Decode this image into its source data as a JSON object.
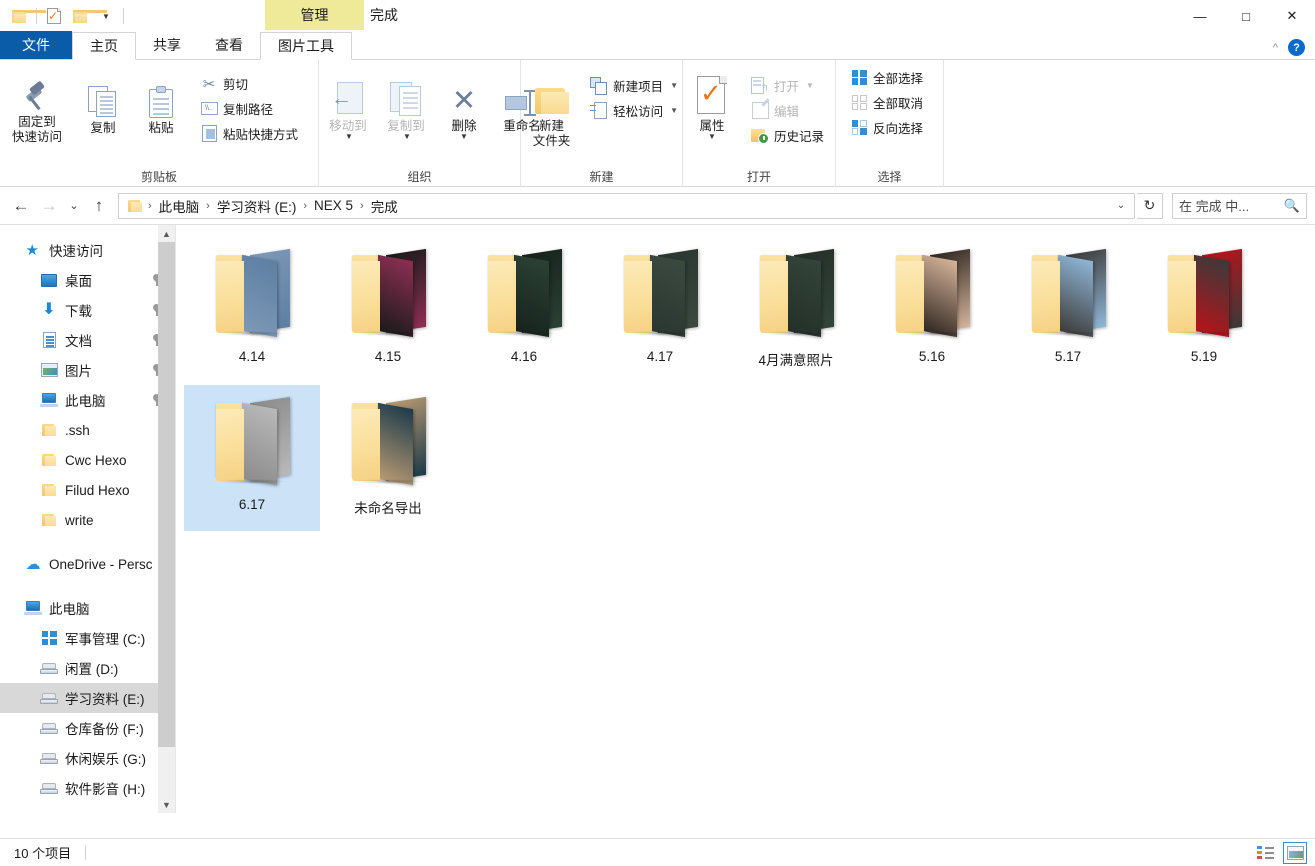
{
  "titlebar": {
    "quick_access": [
      {
        "name": "folder-icon",
        "label": "文件夹"
      },
      {
        "name": "properties-checkmark-icon",
        "label": "属性"
      },
      {
        "name": "new-folder-icon",
        "label": "新建文件夹"
      },
      {
        "name": "customize-dropdown-icon",
        "label": "自定义快速访问工具栏"
      }
    ],
    "context_tab": "管理",
    "window_title": "完成",
    "minimize": "—",
    "maximize": "□",
    "close": "✕"
  },
  "tabs": [
    {
      "label": "文件",
      "type": "file"
    },
    {
      "label": "主页",
      "type": "active"
    },
    {
      "label": "共享",
      "type": "normal"
    },
    {
      "label": "查看",
      "type": "normal"
    },
    {
      "label": "图片工具",
      "type": "context"
    }
  ],
  "ribbon": {
    "collapse_label": "^",
    "help_label": "?",
    "groups": [
      {
        "label": "剪贴板",
        "big": [
          {
            "label": "固定到\n快速访问",
            "line1": "固定到",
            "line2": "快速访问",
            "icon": "pin-icon"
          },
          {
            "label": "复制",
            "icon": "copy-icon"
          },
          {
            "label": "粘贴",
            "icon": "paste-icon"
          }
        ],
        "small": [
          {
            "label": "剪切",
            "icon": "scissors-icon"
          },
          {
            "label": "复制路径",
            "icon": "copy-path-icon"
          },
          {
            "label": "粘贴快捷方式",
            "icon": "paste-shortcut-icon"
          }
        ]
      },
      {
        "label": "组织",
        "big": [
          {
            "label": "移动到",
            "icon": "move-to-icon",
            "disabled": true,
            "caret": true
          },
          {
            "label": "复制到",
            "icon": "copy-to-icon",
            "disabled": true,
            "caret": true
          },
          {
            "label": "删除",
            "icon": "delete-icon",
            "caret": true
          },
          {
            "label": "重命名",
            "icon": "rename-icon"
          }
        ]
      },
      {
        "label": "新建",
        "big": [
          {
            "line1": "新建",
            "line2": "文件夹",
            "icon": "new-folder-icon"
          }
        ],
        "small": [
          {
            "label": "新建项目",
            "icon": "new-item-icon",
            "caret": true
          },
          {
            "label": "轻松访问",
            "icon": "easy-access-icon",
            "caret": true
          }
        ]
      },
      {
        "label": "打开",
        "big": [
          {
            "label": "属性",
            "icon": "properties-icon",
            "caret": true
          }
        ],
        "small": [
          {
            "label": "打开",
            "icon": "open-icon",
            "disabled": true,
            "caret": true
          },
          {
            "label": "编辑",
            "icon": "edit-icon",
            "disabled": true
          },
          {
            "label": "历史记录",
            "icon": "history-icon"
          }
        ]
      },
      {
        "label": "选择",
        "small": [
          {
            "label": "全部选择",
            "icon": "select-all-icon"
          },
          {
            "label": "全部取消",
            "icon": "select-none-icon"
          },
          {
            "label": "反向选择",
            "icon": "invert-selection-icon"
          }
        ]
      }
    ]
  },
  "addressbar": {
    "back": "←",
    "forward": "→",
    "recent": "⌄",
    "up": "↑",
    "breadcrumbs": [
      "此电脑",
      "学习资料 (E:)",
      "NEX 5",
      "完成"
    ],
    "dropdown": "⌄",
    "refresh": "↻",
    "search_placeholder": "在 完成 中...",
    "search_value": ""
  },
  "navpane": {
    "items": [
      {
        "label": "快速访问",
        "icon": "quick-access-star-icon",
        "level": 0,
        "pinned": false,
        "selected": false
      },
      {
        "label": "桌面",
        "icon": "desktop-icon",
        "level": 1,
        "pinned": true,
        "selected": false
      },
      {
        "label": "下载",
        "icon": "downloads-icon",
        "level": 1,
        "pinned": true,
        "selected": false
      },
      {
        "label": "文档",
        "icon": "documents-icon",
        "level": 1,
        "pinned": true,
        "selected": false
      },
      {
        "label": "图片",
        "icon": "pictures-icon",
        "level": 1,
        "pinned": true,
        "selected": false
      },
      {
        "label": "此电脑",
        "icon": "this-pc-icon",
        "level": 1,
        "pinned": true,
        "selected": false
      },
      {
        "label": ".ssh",
        "icon": "folder-icon",
        "level": 1,
        "pinned": false,
        "selected": false
      },
      {
        "label": "Cwc Hexo",
        "icon": "folder-icon",
        "level": 1,
        "pinned": false,
        "selected": false
      },
      {
        "label": "Filud Hexo",
        "icon": "folder-icon",
        "level": 1,
        "pinned": false,
        "selected": false
      },
      {
        "label": "write",
        "icon": "folder-icon",
        "level": 1,
        "pinned": false,
        "selected": false
      },
      {
        "label": "",
        "icon": "spacer",
        "level": 0,
        "spacer": true
      },
      {
        "label": "OneDrive - Persc",
        "icon": "onedrive-icon",
        "level": 0,
        "pinned": false,
        "selected": false
      },
      {
        "label": "",
        "icon": "spacer",
        "level": 0,
        "spacer": true
      },
      {
        "label": "此电脑",
        "icon": "this-pc-icon",
        "level": 0,
        "pinned": false,
        "selected": false
      },
      {
        "label": "军事管理 (C:)",
        "icon": "windows-drive-icon",
        "level": 1,
        "pinned": false,
        "selected": false
      },
      {
        "label": "闲置 (D:)",
        "icon": "drive-icon",
        "level": 1,
        "pinned": false,
        "selected": false
      },
      {
        "label": "学习资料 (E:)",
        "icon": "drive-icon",
        "level": 1,
        "pinned": false,
        "selected": true
      },
      {
        "label": "仓库备份 (F:)",
        "icon": "drive-icon",
        "level": 1,
        "pinned": false,
        "selected": false
      },
      {
        "label": "休闲娱乐 (G:)",
        "icon": "drive-icon",
        "level": 1,
        "pinned": false,
        "selected": false
      },
      {
        "label": "软件影音 (H:)",
        "icon": "drive-icon",
        "level": 1,
        "pinned": false,
        "selected": false
      }
    ]
  },
  "files": [
    {
      "name": "4.14",
      "selected": false,
      "colors": [
        "#5d7fa3",
        "#7d98b6"
      ]
    },
    {
      "name": "4.15",
      "selected": false,
      "colors": [
        "#8e2f53",
        "#1a1a1a"
      ]
    },
    {
      "name": "4.16",
      "selected": false,
      "colors": [
        "#2c4136",
        "#16231c"
      ]
    },
    {
      "name": "4.17",
      "selected": false,
      "colors": [
        "#3b4a40",
        "#2a3630"
      ]
    },
    {
      "name": "4月满意照片",
      "selected": false,
      "colors": [
        "#33443a",
        "#243029"
      ]
    },
    {
      "name": "5.16",
      "selected": false,
      "colors": [
        "#d6b49a",
        "#2e2620"
      ]
    },
    {
      "name": "5.17",
      "selected": false,
      "colors": [
        "#8fb7d8",
        "#3d3a38"
      ]
    },
    {
      "name": "5.19",
      "selected": false,
      "colors": [
        "#3a3a3a",
        "#b8131a"
      ]
    },
    {
      "name": "6.17",
      "selected": true,
      "colors": [
        "#b9b9b9",
        "#8c8c8c"
      ]
    },
    {
      "name": "未命名导出",
      "selected": false,
      "colors": [
        "#1b3a4a",
        "#b89a72"
      ]
    }
  ],
  "statusbar": {
    "item_count": "10 个项目",
    "views": [
      {
        "name": "details-view-button",
        "label": "详细信息",
        "active": false
      },
      {
        "name": "large-icons-view-button",
        "label": "大图标",
        "active": true
      }
    ]
  }
}
